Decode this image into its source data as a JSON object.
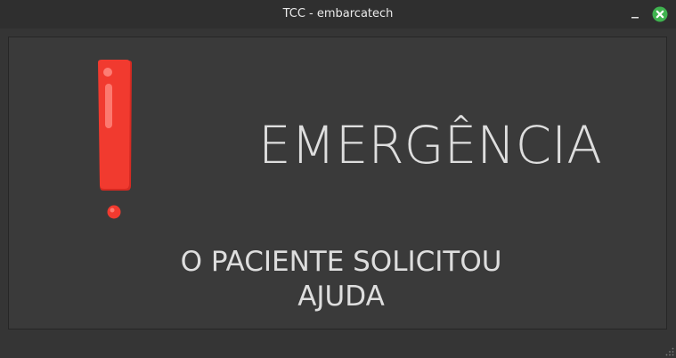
{
  "window": {
    "title": "TCC - embarcatech"
  },
  "alert": {
    "headline": "EMERGÊNCIA",
    "message_line1": "O PACIENTE SOLICITOU",
    "message_line2": "AJUDA",
    "icon": "exclamation-icon",
    "icon_color": "#f13a2f"
  },
  "colors": {
    "titlebar_bg": "#2f2f2f",
    "panel_bg": "#3a3a3a",
    "text": "#dedede",
    "close_button": "#3fb34f"
  }
}
